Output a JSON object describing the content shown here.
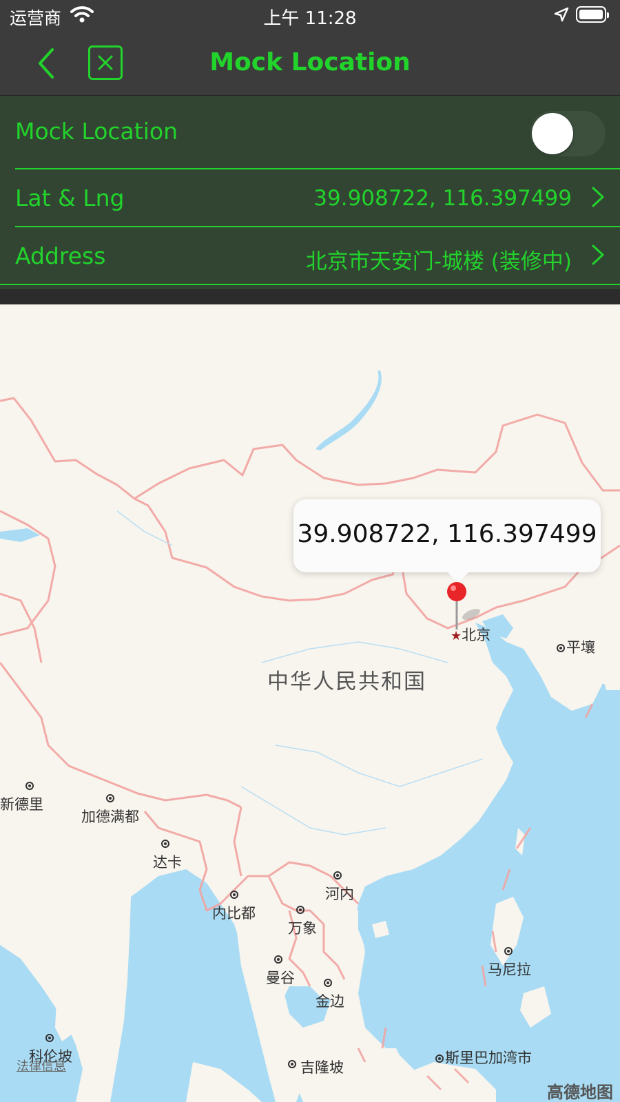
{
  "status_bar": {
    "carrier": "运营商",
    "time": "上午 11:28",
    "wifi_icon": "wifi-icon",
    "location_icon": "location-arrow-icon",
    "battery_icon": "battery-icon"
  },
  "nav": {
    "title": "Mock Location",
    "back_icon": "chevron-left-icon",
    "close_icon": "close-icon"
  },
  "settings": {
    "mock_location": {
      "label": "Mock Location",
      "enabled": false
    },
    "lat_lng": {
      "label": "Lat & Lng",
      "value": "39.908722, 116.397499"
    },
    "address": {
      "label": "Address",
      "value": "北京市天安门-城楼 (装修中)"
    }
  },
  "map": {
    "callout_text": "39.908722, 116.397499",
    "country": "中华人民共和国",
    "beijing": "北京",
    "cities": {
      "pyongyang": "平壤",
      "new_delhi": "新德里",
      "kathmandu": "加德满都",
      "dhaka": "达卡",
      "hanoi": "河内",
      "naypyidaw": "内比都",
      "vientiane": "万象",
      "manila": "马尼拉",
      "bangkok": "曼谷",
      "phnom_penh": "金边",
      "colombo": "科伦坡",
      "kuala_lumpur": "吉隆坡",
      "bandar_seri_begawan": "斯里巴加湾市"
    },
    "legal": "法律信息",
    "logo": "高德地图"
  },
  "colors": {
    "accent": "#22d32c",
    "bar": "#3c3c3c",
    "panel": "#324532",
    "land": "#f8f4ee",
    "water": "#a9dcf4",
    "border": "#f2a3a0"
  }
}
